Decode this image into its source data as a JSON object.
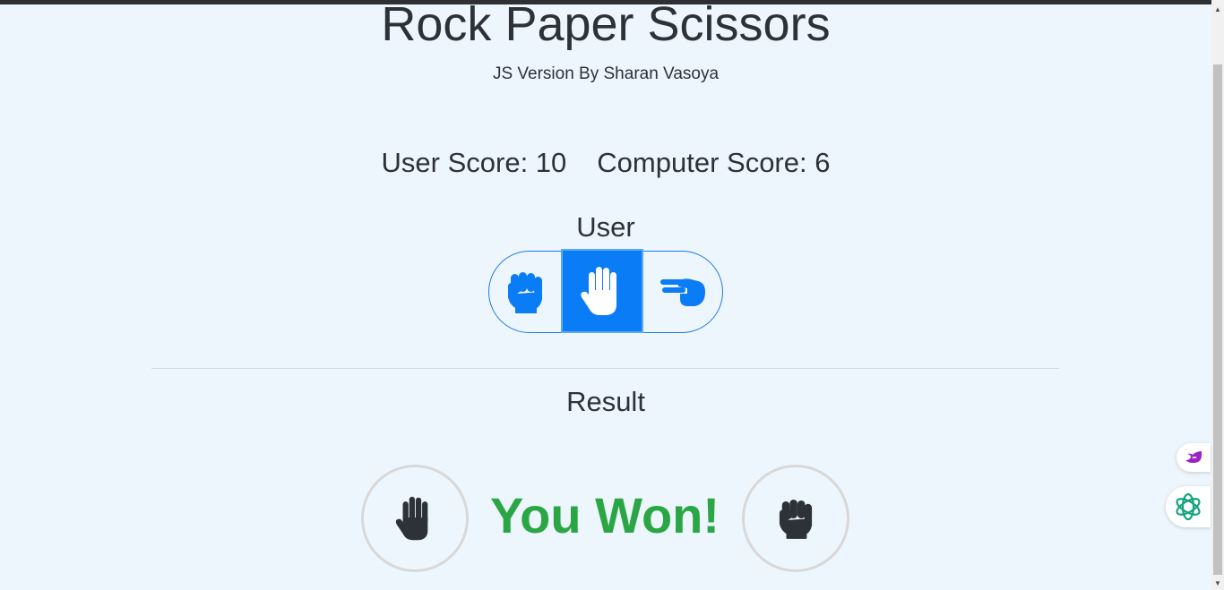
{
  "header": {
    "title": "Rock Paper Scissors",
    "subtitle": "JS Version By Sharan Vasoya"
  },
  "scores": {
    "user_score": "User Score: 10",
    "computer_score": "Computer Score: 6"
  },
  "user_section": {
    "label": "User",
    "choices": [
      {
        "name": "rock",
        "icon": "hand-rock-icon",
        "selected": false
      },
      {
        "name": "paper",
        "icon": "hand-paper-icon",
        "selected": true
      },
      {
        "name": "scissors",
        "icon": "hand-scissors-icon",
        "selected": false
      }
    ]
  },
  "result": {
    "label": "Result",
    "message": "You Won!",
    "user_choice_icon": "hand-paper-icon",
    "computer_choice_icon": "hand-rock-icon"
  },
  "colors": {
    "accent": "#0a7cf5",
    "win": "#2aa744",
    "background": "#eef6fd",
    "text": "#2d3138"
  }
}
